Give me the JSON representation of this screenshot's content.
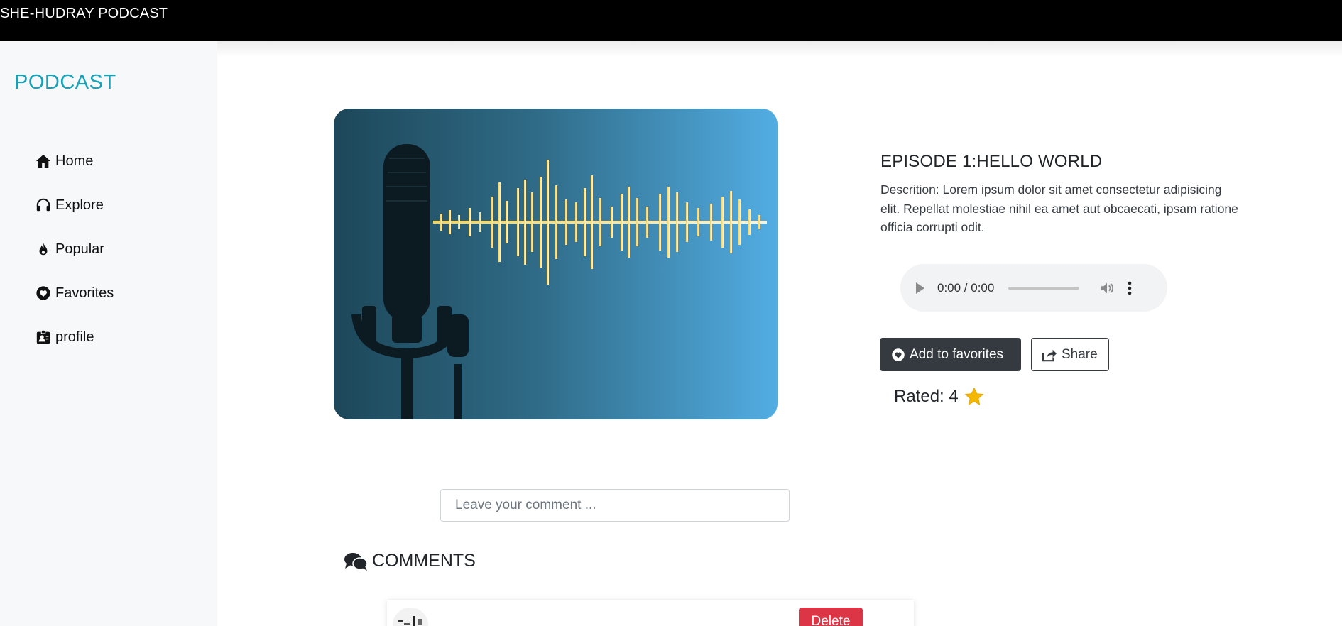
{
  "header": {
    "brand": "SHE-HUDRAY PODCAST"
  },
  "sidebar": {
    "logo": "PODCAST",
    "items": [
      {
        "label": "Home",
        "icon": "house-icon"
      },
      {
        "label": "Explore",
        "icon": "headphones-icon"
      },
      {
        "label": "Popular",
        "icon": "fire-icon"
      },
      {
        "label": "Favorites",
        "icon": "heart-circle-icon"
      },
      {
        "label": "profile",
        "icon": "person-badge-icon"
      }
    ]
  },
  "episode": {
    "title": "EPISODE 1:HELLO WORLD",
    "description": "Descrition: Lorem ipsum dolor sit amet consectetur adipisicing elit. Repellat molestiae nihil ea amet aut obcaecati, ipsam ratione officia corrupti odit.",
    "cover_icon": "microphone-waveform-image"
  },
  "player": {
    "time": "0:00 / 0:00"
  },
  "actions": {
    "favorite_label": "Add to favorites",
    "share_label": "Share"
  },
  "rating": {
    "label": "Rated: 4",
    "value": 4
  },
  "comment_form": {
    "placeholder": "Leave your comment ..."
  },
  "comments": {
    "heading": "COMMENTS",
    "delete_label": "Delete"
  },
  "colors": {
    "accent": "#17a2b8",
    "dark": "#343a40",
    "danger": "#dc3545",
    "star": "#f5b800"
  }
}
